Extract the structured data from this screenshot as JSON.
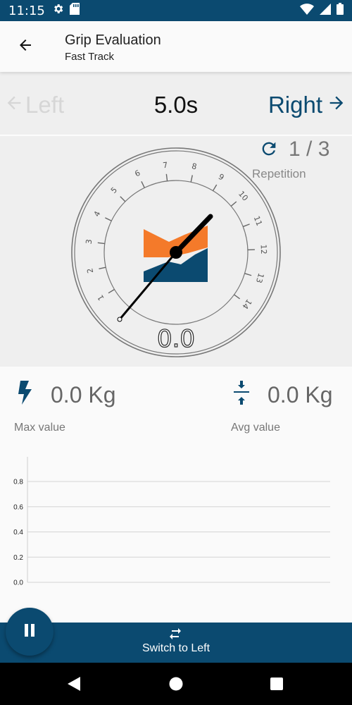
{
  "status_bar": {
    "time": "11:15"
  },
  "app_bar": {
    "title": "Grip Evaluation",
    "subtitle": "Fast Track"
  },
  "side_selector": {
    "left_label": "Left",
    "timer": "5.0s",
    "right_label": "Right"
  },
  "repetition": {
    "count": "1 / 3",
    "label": "Repetition"
  },
  "gauge": {
    "display_value": "0.0",
    "needle_value": 0.0,
    "scale_labels": [
      "1",
      "2",
      "3",
      "4",
      "5",
      "6",
      "7",
      "8",
      "9",
      "10",
      "11",
      "12",
      "13",
      "14"
    ],
    "logo_colors": {
      "orange": "#f47a2a",
      "blue": "#0b4a70"
    }
  },
  "stats": {
    "max": {
      "value": "0.0 Kg",
      "label": "Max value"
    },
    "avg": {
      "value": "0.0 Kg",
      "label": "Avg value"
    }
  },
  "chart_data": {
    "type": "line",
    "y_ticks": [
      "0.0",
      "0.2",
      "0.4",
      "0.6",
      "0.8"
    ],
    "ylim": [
      0,
      0.8
    ],
    "series": [],
    "grid": true
  },
  "bottom_bar": {
    "switch_label": "Switch to Left"
  },
  "colors": {
    "primary": "#0b4a70",
    "accent": "#f47a2a",
    "background": "#efefef"
  }
}
